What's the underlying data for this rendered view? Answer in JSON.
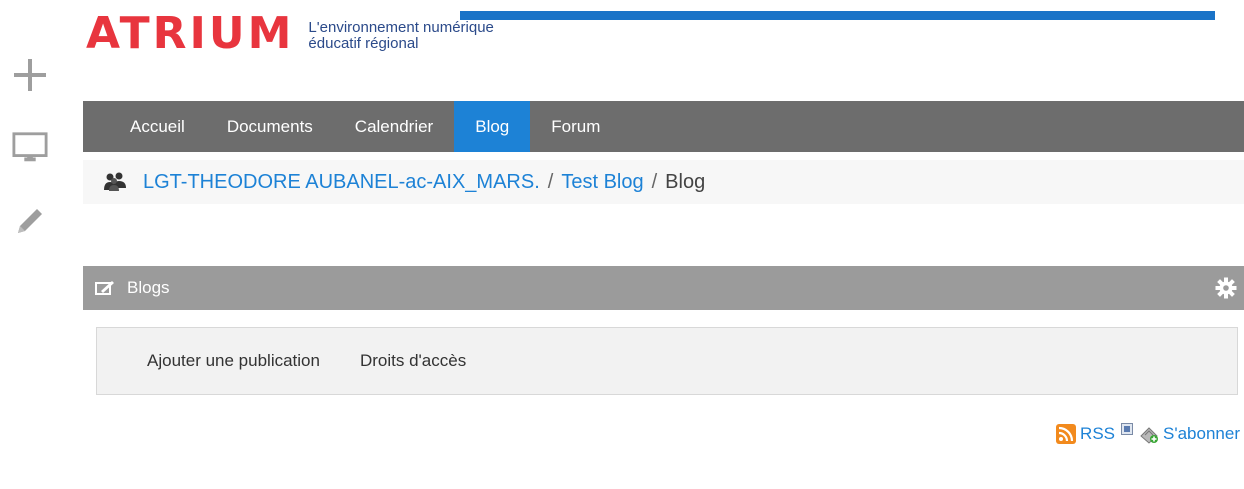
{
  "header": {
    "logo_text": "ATRIUM",
    "tagline_line1": "L'environnement numérique",
    "tagline_line2": "éducatif régional",
    "brand_color": "#e8353e",
    "accent_color": "#1a73c7"
  },
  "left_toolbar": {
    "items": [
      {
        "icon": "plus-icon"
      },
      {
        "icon": "monitor-icon"
      },
      {
        "icon": "pencil-icon"
      }
    ]
  },
  "nav": {
    "items": [
      {
        "label": "Accueil"
      },
      {
        "label": "Documents"
      },
      {
        "label": "Calendrier"
      },
      {
        "label": "Blog",
        "active": true
      },
      {
        "label": "Forum"
      }
    ]
  },
  "breadcrumb": {
    "icon": "group-icon",
    "items": [
      {
        "label": "LGT-THEODORE AUBANEL-ac-AIX_MARS."
      },
      {
        "label": "Test Blog"
      },
      {
        "label": "Blog"
      }
    ],
    "separator": "/"
  },
  "panel": {
    "title": "Blogs",
    "icon": "blog-icon",
    "settings_icon": "gear-icon"
  },
  "subnav": {
    "items": [
      {
        "label": "Ajouter une publication"
      },
      {
        "label": "Droits d'accès"
      }
    ]
  },
  "feeds": {
    "rss_label": "RSS",
    "subscribe_label": "S'abonner"
  }
}
